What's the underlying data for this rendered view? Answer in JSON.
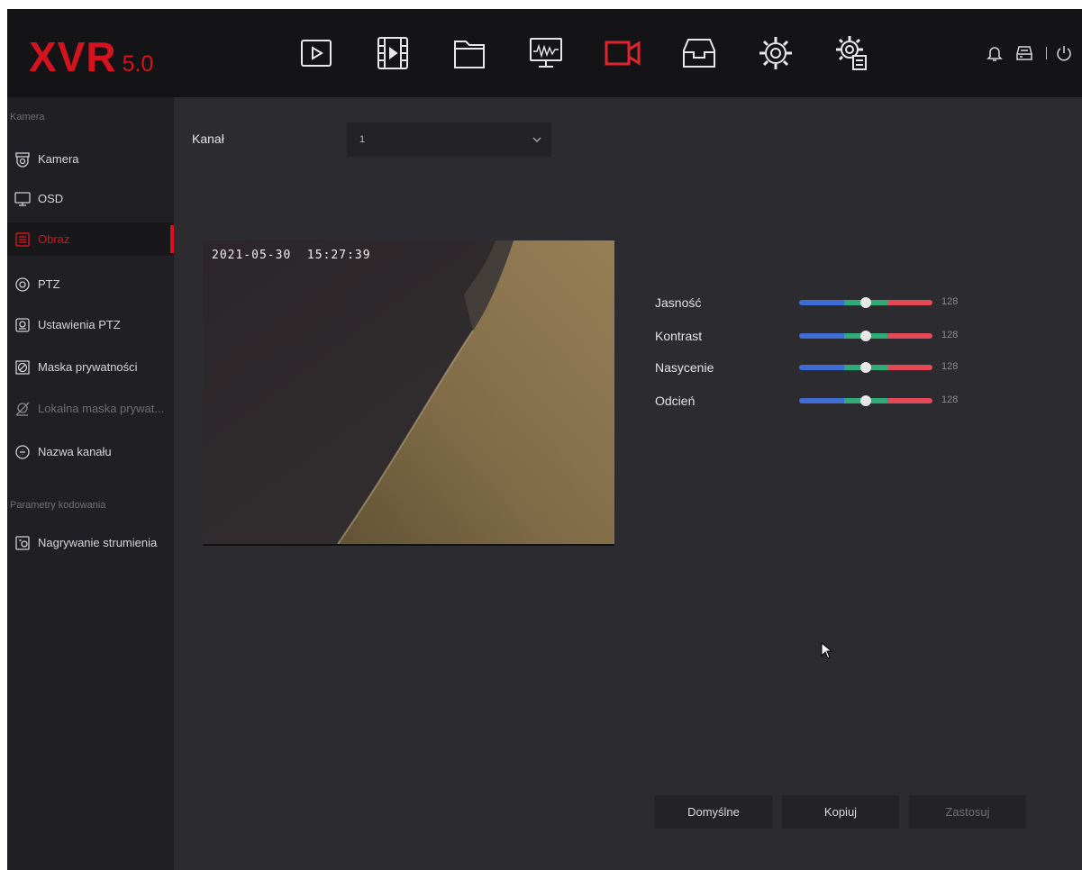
{
  "header": {
    "logo_main": "XVR",
    "logo_version": "5.0",
    "nav_icons": [
      "playback-icon",
      "video-clip-icon",
      "folder-icon",
      "monitor-icon",
      "camera-icon",
      "storage-icon",
      "settings-icon",
      "system-settings-icon"
    ],
    "active_nav": "camera-icon",
    "system_icons": [
      "bell-icon",
      "disk-icon",
      "power-icon"
    ]
  },
  "sidebar": {
    "section1": "Kamera",
    "items": [
      {
        "label": "Kamera",
        "icon": "camera-dome-icon"
      },
      {
        "label": "OSD",
        "icon": "monitor-icon"
      },
      {
        "label": "Obraz",
        "icon": "image-icon",
        "active": true
      },
      {
        "label": "PTZ",
        "icon": "ptz-icon"
      },
      {
        "label": "Ustawienia PTZ",
        "icon": "ptz-settings-icon"
      },
      {
        "label": "Maska prywatności",
        "icon": "privacy-mask-icon"
      },
      {
        "label": "Lokalna maska prywat...",
        "icon": "local-mask-icon",
        "disabled": true
      },
      {
        "label": "Nazwa kanału",
        "icon": "channel-name-icon"
      }
    ],
    "section2": "Parametry kodowania",
    "items2": [
      {
        "label": "Nagrywanie strumienia",
        "icon": "stream-icon"
      }
    ]
  },
  "main": {
    "channel_label": "Kanał",
    "channel_value": "1",
    "preview_timestamp": "2021-05-30  15:27:39",
    "sliders": [
      {
        "label": "Jasność",
        "value": 128
      },
      {
        "label": "Kontrast",
        "value": 128
      },
      {
        "label": "Nasycenie",
        "value": 128
      },
      {
        "label": "Odcień",
        "value": 128
      }
    ],
    "slider_max": 255,
    "buttons": {
      "default": "Domyślne",
      "copy": "Kopiuj",
      "apply": "Zastosuj"
    }
  },
  "colors": {
    "accent": "#d4131e",
    "slider_blue": "#3f6bd4",
    "slider_green": "#2eab77",
    "slider_red": "#e44a58"
  }
}
